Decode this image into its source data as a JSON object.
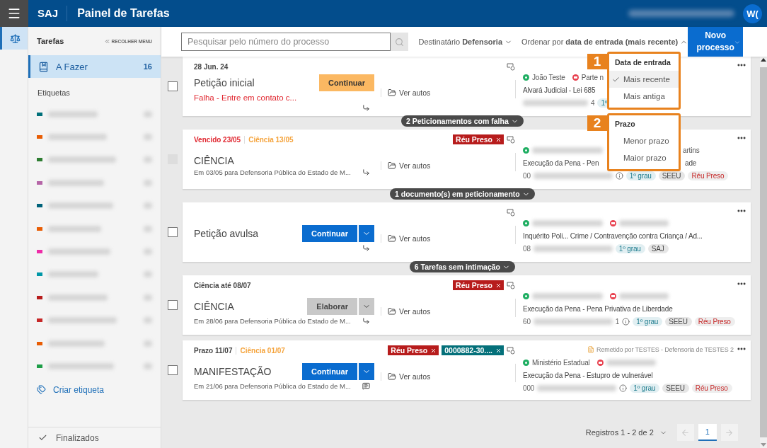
{
  "header": {
    "brand": "SAJ",
    "title": "Painel de Tarefas",
    "avatar": "W("
  },
  "rail": {
    "items": [
      {
        "selected": true
      }
    ]
  },
  "sidebar": {
    "heading": "Tarefas",
    "collapse": "RECOLHER MENU",
    "items": [
      {
        "label": "A Fazer",
        "count": "16",
        "selected": true
      }
    ],
    "tags_heading": "Etiquetas",
    "tags": [
      {
        "color": "#00707a"
      },
      {
        "color": "#e85d04"
      },
      {
        "color": "#2e7d32"
      },
      {
        "color": "#b565a7"
      },
      {
        "color": "#00627a"
      },
      {
        "color": "#e85d04"
      },
      {
        "color": "#ee2ca8"
      },
      {
        "color": "#0097a7"
      },
      {
        "color": "#b71c1c"
      },
      {
        "color": "#c62828"
      },
      {
        "color": "#e85d04"
      },
      {
        "color": "#1e9e48"
      }
    ],
    "create": "Criar etiqueta",
    "finished": "Finalizados"
  },
  "toolbar": {
    "search": {
      "placeholder": "Pesquisar pelo número do processo"
    },
    "recipient": {
      "label": "Destinatário",
      "value": "Defensoria"
    },
    "sort": {
      "label": "Ordenar por",
      "value": "data de entrada (mais recente)",
      "expanded": true
    },
    "new_button": {
      "line1": "Novo",
      "line2": "processo"
    }
  },
  "sort_menu": {
    "groups": [
      {
        "number": "1",
        "title": "Data de entrada",
        "options": [
          {
            "label": "Mais recente",
            "selected": true
          },
          {
            "label": "Mais antiga",
            "selected": false
          }
        ]
      },
      {
        "number": "2",
        "title": "Prazo",
        "options": [
          {
            "label": "Menor prazo",
            "selected": false
          },
          {
            "label": "Maior prazo",
            "selected": false
          }
        ]
      }
    ]
  },
  "list": [
    {
      "kind": "card",
      "disabled": false,
      "status": [
        {
          "text": "28 Jun. 24",
          "kind": "plain"
        }
      ],
      "title": "Petição inicial",
      "alert": "Falha - Entre em contato c...",
      "action": {
        "label": "Continuar",
        "kind": "warning"
      },
      "note_mark": {
        "kind": "reply"
      },
      "link": "Ver autos",
      "parties": [
        {
          "kind": "active",
          "name": "João Teste"
        },
        {
          "kind": "passive",
          "name": "Parte n"
        }
      ],
      "class": "Alvará Judicial - Lei 685",
      "number_suffix": "4",
      "badges": [
        {
          "text": "1º",
          "kind": "grade"
        }
      ]
    },
    {
      "kind": "group",
      "label": "2 Peticionamentos com falha"
    },
    {
      "kind": "card",
      "disabled": true,
      "status": [
        {
          "text": "Vencido 23/05",
          "kind": "overdue"
        },
        {
          "text": "Ciência 13/05",
          "kind": "notice"
        }
      ],
      "tags": [
        {
          "text": "Réu Preso",
          "color": "#b71c1c"
        }
      ],
      "title": "CIÊNCIA",
      "note": "Em 03/05 para Defensoria Pública do Estado de M...",
      "note_mark": {
        "kind": "reply"
      },
      "link": "Ver autos",
      "parties": [
        {
          "kind": "active"
        }
      ],
      "party_tail": "artins",
      "class": "Execução da Pena - Pen",
      "class_tail": "ade",
      "number_prefix": "00",
      "info": true,
      "badges": [
        {
          "text": "1º grau",
          "kind": "grade"
        },
        {
          "text": "SEEU",
          "kind": "system"
        },
        {
          "text": "Réu Preso",
          "kind": "alert"
        }
      ]
    },
    {
      "kind": "group",
      "label": "1 documento(s) em peticionamento"
    },
    {
      "kind": "card",
      "disabled": false,
      "title": "Petição avulsa",
      "action": {
        "label": "Continuar",
        "kind": "primary",
        "split": true
      },
      "note_mark": {
        "kind": "reply"
      },
      "link": "Ver autos",
      "parties": [
        {
          "kind": "active"
        },
        {
          "kind": "passive"
        }
      ],
      "class": "Inquérito Poli...  Crime / Contravenção contra Criança / Ad...",
      "number_prefix": "08",
      "badges": [
        {
          "text": "1º grau",
          "kind": "grade"
        },
        {
          "text": "SAJ",
          "kind": "system"
        }
      ]
    },
    {
      "kind": "group",
      "label": "6 Tarefas sem intimação"
    },
    {
      "kind": "card",
      "disabled": false,
      "status": [
        {
          "text": "Ciência até 08/07",
          "kind": "plain"
        }
      ],
      "tags": [
        {
          "text": "Réu Preso",
          "color": "#b71c1c"
        }
      ],
      "title": "CIÊNCIA",
      "action": {
        "label": "Elaborar",
        "kind": "secondary",
        "split": true
      },
      "note": "Em 28/06 para Defensoria Pública do Estado de M...",
      "note_mark": {
        "kind": "reply"
      },
      "link": "Ver autos",
      "parties": [
        {
          "kind": "active"
        },
        {
          "kind": "passive"
        }
      ],
      "class": "Execução da Pena - Pena Privativa de Liberdade",
      "number_prefix": "60",
      "number_suffix": "1",
      "info": true,
      "badges": [
        {
          "text": "1º grau",
          "kind": "grade"
        },
        {
          "text": "SEEU",
          "kind": "system"
        },
        {
          "text": "Réu Preso",
          "kind": "alert"
        }
      ]
    },
    {
      "kind": "card",
      "disabled": false,
      "status": [
        {
          "text": "Prazo 11/07",
          "kind": "plain"
        },
        {
          "text": "Ciência 01/07",
          "kind": "notice"
        }
      ],
      "tags": [
        {
          "text": "Réu Preso",
          "color": "#b71c1c"
        },
        {
          "text": "0000882-30....",
          "color": "#04707a"
        }
      ],
      "title": "MANIFESTAÇÃO",
      "action": {
        "label": "Continuar",
        "kind": "primary",
        "split": true
      },
      "note": "Em 21/06 para Defensoria Pública do Estado de M...",
      "note_mark": {
        "kind": "comment"
      },
      "link": "Ver autos",
      "remark": "Remetido",
      "remark_by": "por TESTES - Defensoria de TESTES 2",
      "parties": [
        {
          "kind": "active",
          "name": "Ministério Estadual"
        },
        {
          "kind": "passive"
        }
      ],
      "class": "Execução da Pena - Estupro de vulnerável",
      "number_prefix": "000",
      "info": true,
      "badges": [
        {
          "text": "1º grau",
          "kind": "grade"
        },
        {
          "text": "SEEU",
          "kind": "system"
        },
        {
          "text": "Réu Preso",
          "kind": "alert"
        }
      ]
    }
  ],
  "pagination": {
    "summary": "Registros 1 - 2 de 2",
    "pages": [
      {
        "label": "1",
        "selected": true
      }
    ]
  }
}
